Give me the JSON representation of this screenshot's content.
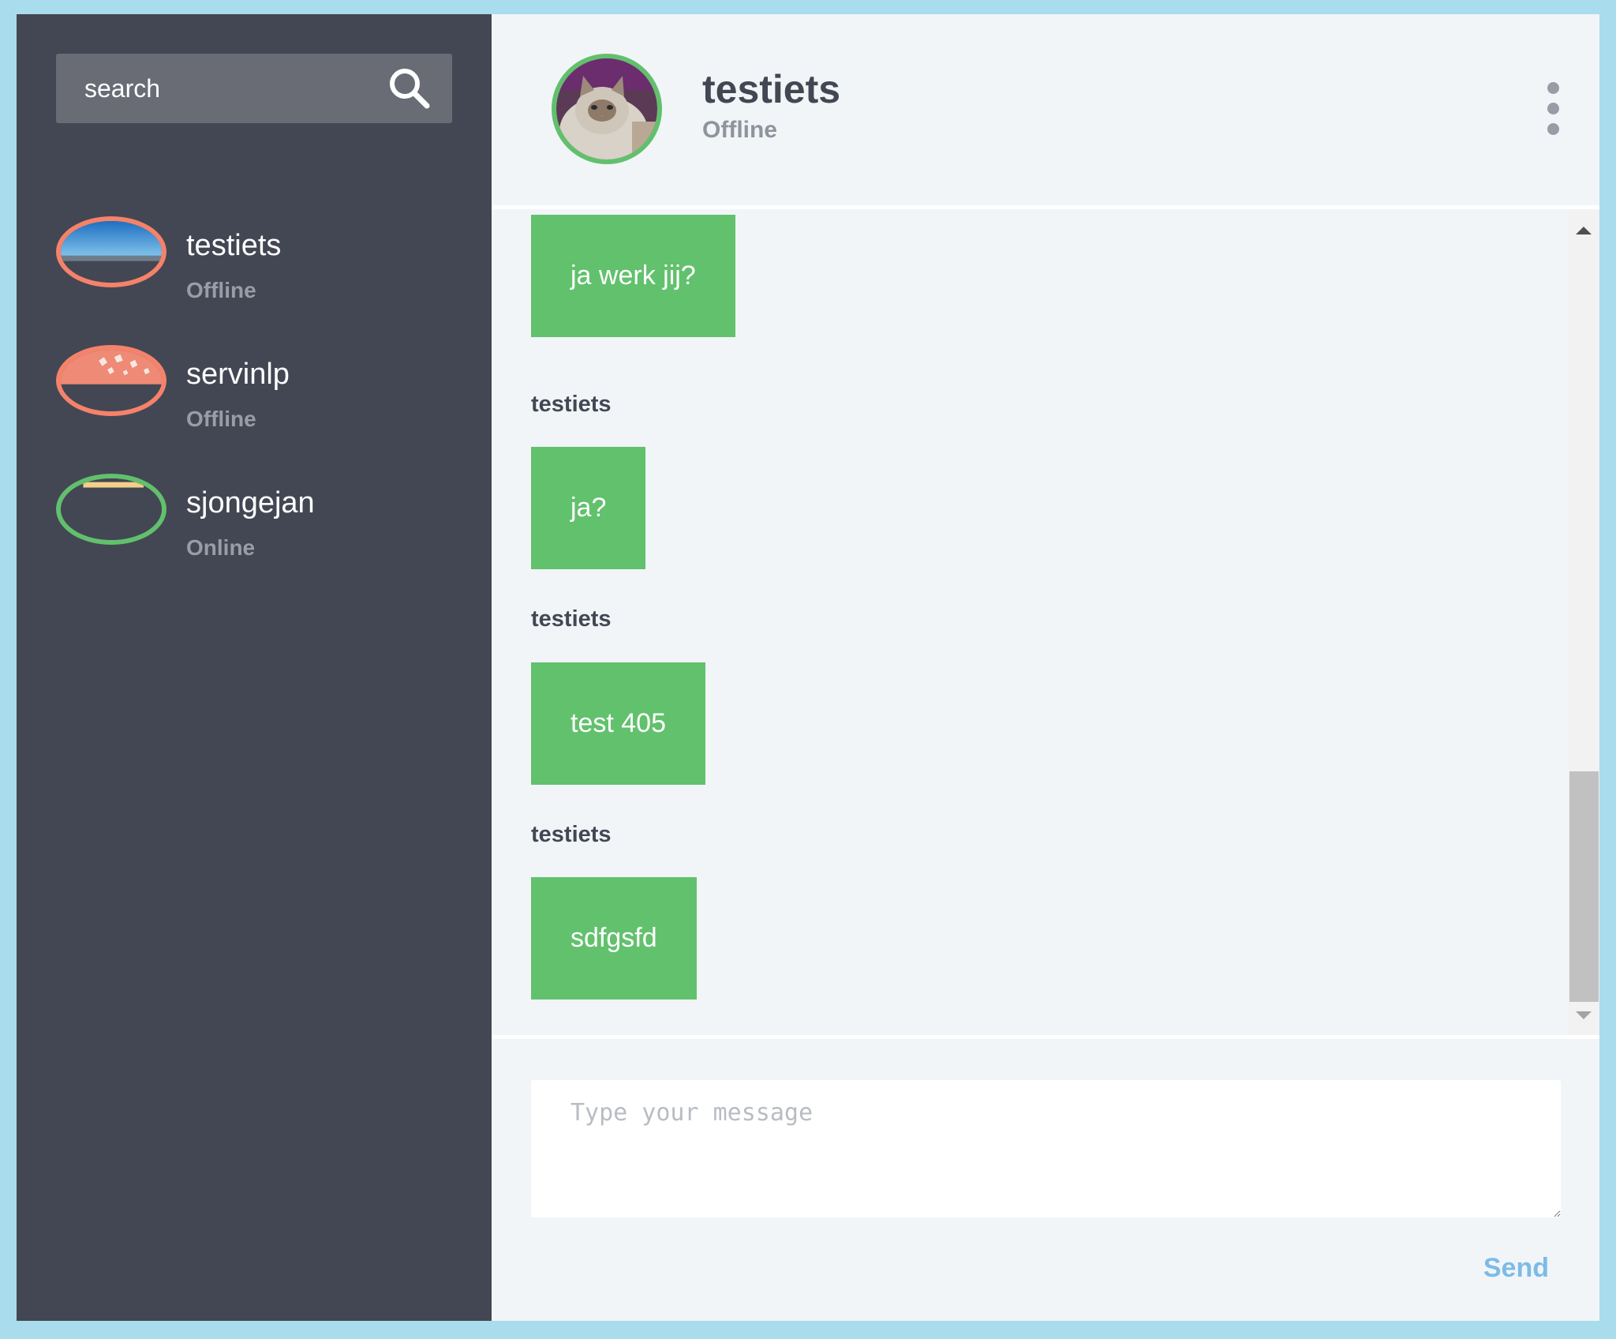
{
  "search": {
    "placeholder": "search"
  },
  "contacts": [
    {
      "name": "testiets",
      "status": "Offline"
    },
    {
      "name": "servinlp",
      "status": "Offline"
    },
    {
      "name": "sjongejan",
      "status": "Online"
    }
  ],
  "header": {
    "name": "testiets",
    "status": "Offline"
  },
  "messages": [
    {
      "text": "ja werk jij?"
    },
    {
      "sender": "testiets",
      "text": "ja?"
    },
    {
      "sender": "testiets",
      "text": "test 405"
    },
    {
      "sender": "testiets",
      "text": "sdfgsfd"
    }
  ],
  "composer": {
    "placeholder": "Type your message",
    "send_label": "Send"
  },
  "colors": {
    "background": "#a9dcec",
    "sidebar": "#434753",
    "bubble": "#62c16d",
    "offline": "#f5826a",
    "online": "#62c06d",
    "send": "#7dbbe6"
  }
}
